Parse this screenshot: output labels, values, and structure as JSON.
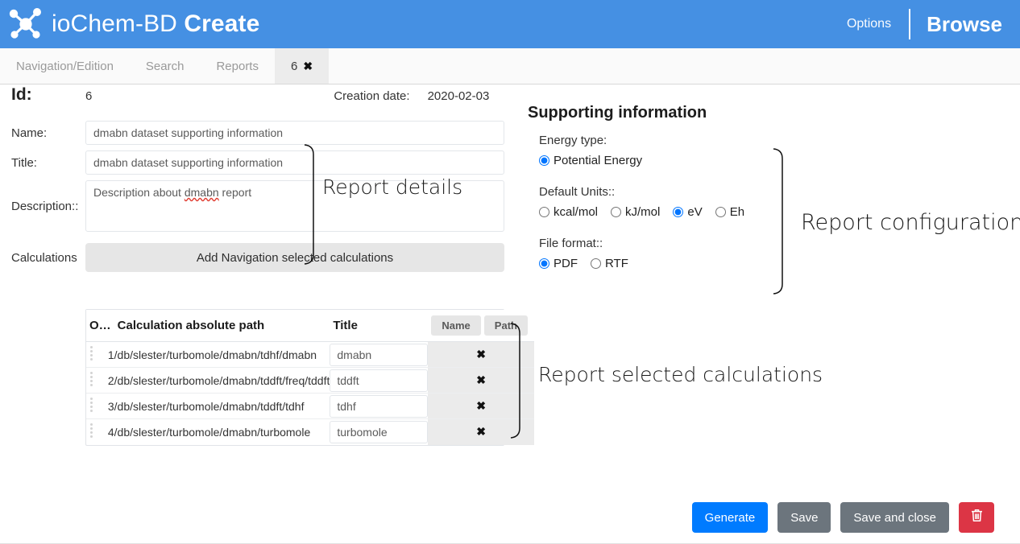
{
  "header": {
    "logo_icon": "molecule-icon",
    "brand_light": "ioChem-BD",
    "brand_bold": "Create",
    "options_label": "Options",
    "browse_label": "Browse",
    "bg_color": "#4590e3"
  },
  "tabs": [
    {
      "label": "Navigation/Edition",
      "active": false
    },
    {
      "label": "Search",
      "active": false
    },
    {
      "label": "Reports",
      "active": false
    },
    {
      "label": "6",
      "active": true,
      "close_icon": "close-icon",
      "close_glyph": "✖"
    }
  ],
  "details": {
    "id_label": "Id:",
    "id_value": "6",
    "creation_date_label": "Creation date:",
    "creation_date_value": "2020-02-03",
    "name_label": "Name:",
    "name_value": "dmabn dataset supporting information",
    "title_label": "Title:",
    "title_value": "dmabn dataset supporting information",
    "description_label": "Description::",
    "description_value": "Description about dmabn report",
    "description_spellword": "dmabn",
    "description_pre": "Description about ",
    "description_post": " report",
    "calculations_label": "Calculations",
    "add_calculations_label": "Add Navigation selected calculations"
  },
  "table": {
    "columns": {
      "order": "O…",
      "path": "Calculation absolute path",
      "title": "Title",
      "name_button": "Name",
      "path_button": "Path"
    },
    "rows": [
      {
        "order": "1",
        "path": "/db/slester/turbomole/dmabn/tdhf/dmabn",
        "title": "dmabn",
        "delete_glyph": "✖"
      },
      {
        "order": "2",
        "path": "/db/slester/turbomole/dmabn/tddft/freq/tddft",
        "title": "tddft",
        "delete_glyph": "✖"
      },
      {
        "order": "3",
        "path": "/db/slester/turbomole/dmabn/tddft/tdhf",
        "title": "tdhf",
        "delete_glyph": "✖"
      },
      {
        "order": "4",
        "path": "/db/slester/turbomole/dmabn/turbomole",
        "title": "turbomole",
        "delete_glyph": "✖"
      }
    ]
  },
  "supporting": {
    "panel_title": "Supporting information",
    "energy_type_label": "Energy type:",
    "energy_type_options": [
      {
        "label": "Potential Energy",
        "checked": true
      }
    ],
    "default_units_label": "Default Units::",
    "default_units_options": [
      {
        "label": "kcal/mol",
        "checked": false
      },
      {
        "label": "kJ/mol",
        "checked": false
      },
      {
        "label": "eV",
        "checked": true
      },
      {
        "label": "Eh",
        "checked": false
      }
    ],
    "file_format_label": "File format::",
    "file_format_options": [
      {
        "label": "PDF",
        "checked": true
      },
      {
        "label": "RTF",
        "checked": false
      }
    ]
  },
  "annotations": {
    "report_details": "Report details",
    "report_configuration": "Report configuration",
    "report_selected_calculations": "Report selected calculations"
  },
  "footer": {
    "generate_label": "Generate",
    "save_label": "Save",
    "save_close_label": "Save and close",
    "delete_icon": "trash-icon",
    "generate_color": "#007bff",
    "save_color": "#6c757d",
    "delete_color": "#dc3545"
  }
}
